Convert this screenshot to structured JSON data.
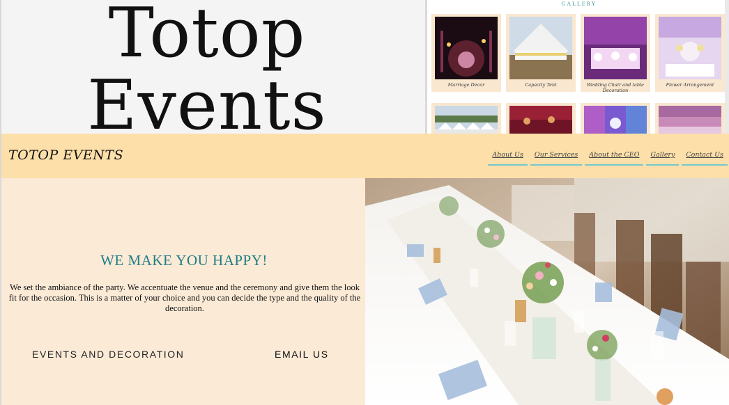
{
  "hero": {
    "title_line1": "Totop",
    "title_line2": "Events"
  },
  "gallery": {
    "label": "GALLERY",
    "items": [
      {
        "caption": "Marriage Decor"
      },
      {
        "caption": "Capacity Tent"
      },
      {
        "caption": "Wedding Chair and table Decoration"
      },
      {
        "caption": "Flower Arrangement"
      }
    ],
    "watermark": "Totop Events"
  },
  "navbar": {
    "brand": "TOTOP EVENTS",
    "items": [
      "About Us",
      "Our Services",
      "About the CEO",
      "Gallery",
      "Contact Us"
    ]
  },
  "main": {
    "tagline": "WE MAKE YOU HAPPY!",
    "description": "We set the ambiance of the party. We accentuate the venue and the ceremony and give them the look fit for the occasion. This is a matter of your choice and you can decide the type and the quality of the decoration.",
    "events_link": "EVENTS AND DECORATION",
    "email_link": "EMAIL US"
  },
  "colors": {
    "nav_bg": "#fddfa9",
    "content_bg": "#fbead6",
    "accent": "#1f7f86",
    "underline": "#76c7cf"
  }
}
